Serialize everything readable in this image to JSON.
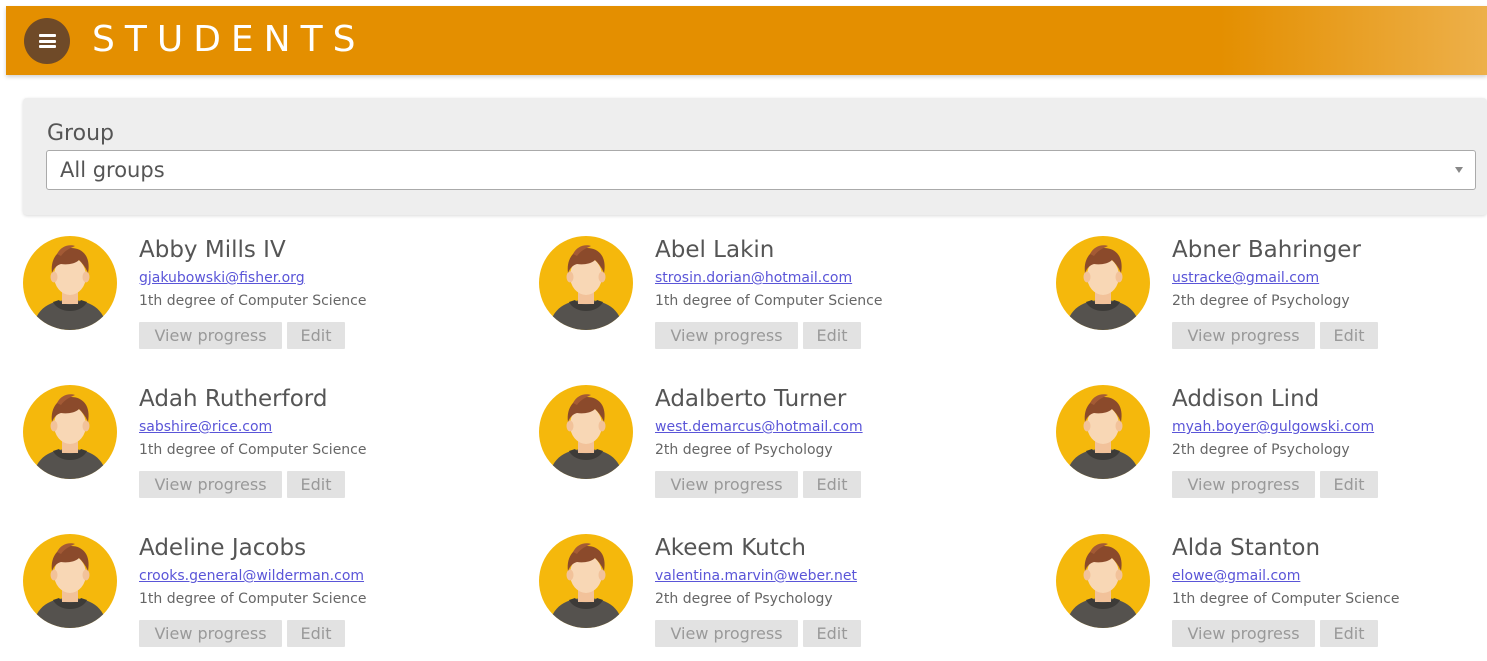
{
  "header": {
    "title": "STUDENTS",
    "menu_icon": "hamburger-menu-icon",
    "background_color": "#e48f00"
  },
  "filter": {
    "label": "Group",
    "selected": "All groups"
  },
  "actions": {
    "view_progress_label": "View progress",
    "edit_label": "Edit"
  },
  "students": [
    {
      "name": "Abby Mills IV",
      "email": "gjakubowski@fisher.org",
      "degree": "1th degree of Computer Science"
    },
    {
      "name": "Abel Lakin",
      "email": "strosin.dorian@hotmail.com",
      "degree": "1th degree of Computer Science"
    },
    {
      "name": "Abner Bahringer",
      "email": "ustracke@gmail.com",
      "degree": "2th degree of Psychology"
    },
    {
      "name": "Adah Rutherford",
      "email": "sabshire@rice.com",
      "degree": "1th degree of Computer Science"
    },
    {
      "name": "Adalberto Turner",
      "email": "west.demarcus@hotmail.com",
      "degree": "2th degree of Psychology"
    },
    {
      "name": "Addison Lind",
      "email": "myah.boyer@gulgowski.com",
      "degree": "2th degree of Psychology"
    },
    {
      "name": "Adeline Jacobs",
      "email": "crooks.general@wilderman.com",
      "degree": "1th degree of Computer Science"
    },
    {
      "name": "Akeem Kutch",
      "email": "valentina.marvin@weber.net",
      "degree": "2th degree of Psychology"
    },
    {
      "name": "Alda Stanton",
      "email": "elowe@gmail.com",
      "degree": "1th degree of Computer Science"
    }
  ]
}
